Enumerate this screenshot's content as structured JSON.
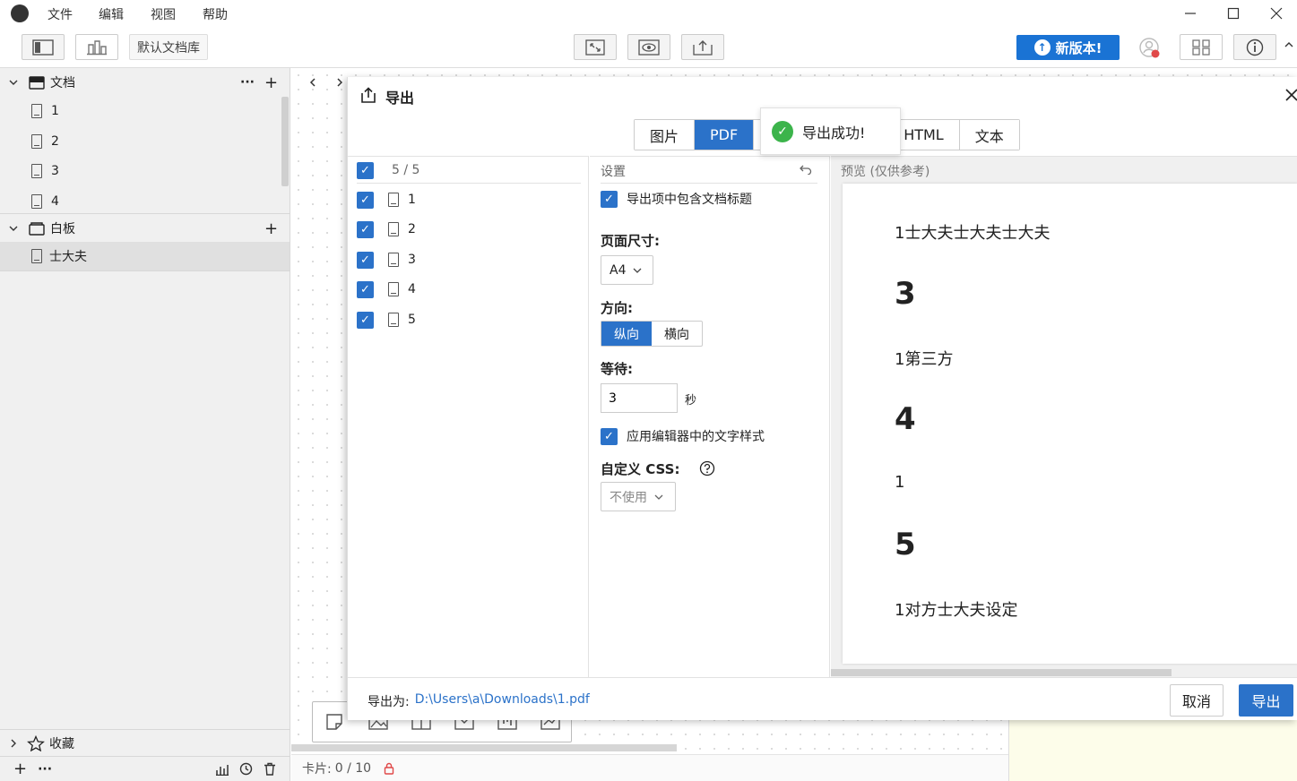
{
  "menu": {
    "file": "文件",
    "edit": "编辑",
    "view": "视图",
    "help": "帮助"
  },
  "toolbar": {
    "library": "默认文档库",
    "new_version": "新版本!"
  },
  "sidebar": {
    "docs_section": "文档",
    "docs_more": "···",
    "docs": [
      "1",
      "2",
      "3",
      "4"
    ],
    "board_section": "白板",
    "boards": [
      "士大夫"
    ],
    "favorites": "收藏",
    "bottom_more": "···"
  },
  "status": {
    "cards_label": "卡片:",
    "cards_value": "0 / 10"
  },
  "dialog": {
    "title": "导出",
    "tabs": [
      "图片",
      "PDF",
      "HTML",
      "文本"
    ],
    "active_tab": "PDF",
    "toast": "导出成功!",
    "list": {
      "count": "5 / 5",
      "items": [
        "1",
        "2",
        "3",
        "4",
        "5"
      ]
    },
    "settings": {
      "header": "设置",
      "include_title": "导出项中包含文档标题",
      "page_size_label": "页面尺寸:",
      "page_size_value": "A4",
      "orientation_label": "方向:",
      "portrait": "纵向",
      "landscape": "横向",
      "wait_label": "等待:",
      "wait_value": "3",
      "wait_unit": "秒",
      "apply_style": "应用编辑器中的文字样式",
      "css_label": "自定义 CSS:",
      "css_value": "不使用"
    },
    "preview": {
      "header": "预览 (仅供参考)",
      "lines": [
        "1士大夫士大夫士大夫",
        "3",
        "1第三方",
        "4",
        "1",
        "5",
        "1对方士大夫设定"
      ]
    },
    "footer": {
      "export_to_label": "导出为:",
      "export_path": "D:\\Users\\a\\Downloads\\1.pdf",
      "cancel": "取消",
      "export": "导出"
    }
  },
  "colors": {
    "accent": "#2b72c9",
    "new_version": "#1a73d4",
    "success": "#3cb44b"
  }
}
